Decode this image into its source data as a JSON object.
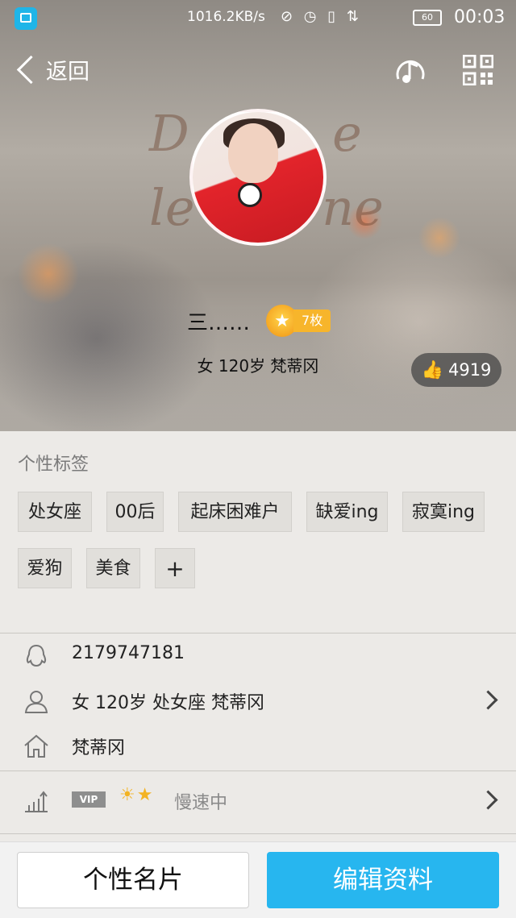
{
  "status_bar": {
    "speed": "1016.2KB/s",
    "battery": "60",
    "time": "00:03"
  },
  "header": {
    "back_label": "返回"
  },
  "profile": {
    "name": "三……",
    "medal_count": "7枚",
    "info": "女 120岁 梵蒂冈",
    "likes": "4919"
  },
  "tags": {
    "title": "个性标签",
    "items": [
      "处女座",
      "00后",
      "起床困难户",
      "缺爱ing",
      "寂寞ing",
      "爱狗",
      "美食"
    ],
    "add_label": "+"
  },
  "details": {
    "qq": "2179747181",
    "basic": "女  120岁  处女座  梵蒂冈",
    "location": "梵蒂冈",
    "vip_badge": "VIP",
    "vip_status": "慢速中"
  },
  "buttons": {
    "card": "个性名片",
    "edit": "编辑资料"
  },
  "colors": {
    "accent": "#27b6ef",
    "medal": "#f7b52b"
  }
}
